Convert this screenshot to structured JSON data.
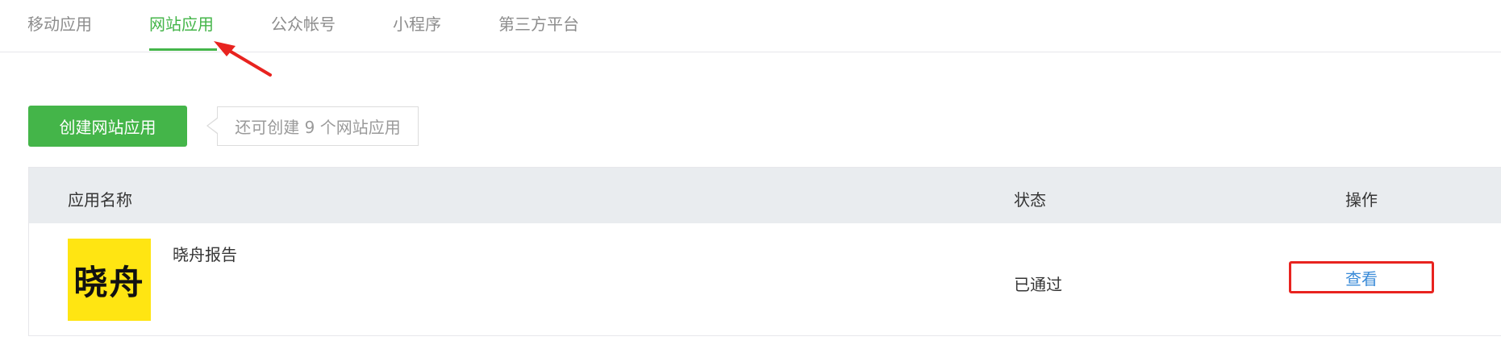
{
  "tabs": [
    {
      "label": "移动应用",
      "active": false
    },
    {
      "label": "网站应用",
      "active": true
    },
    {
      "label": "公众帐号",
      "active": false
    },
    {
      "label": "小程序",
      "active": false
    },
    {
      "label": "第三方平台",
      "active": false
    }
  ],
  "toolbar": {
    "create_label": "创建网站应用",
    "remaining_tip": "还可创建 9 个网站应用"
  },
  "table": {
    "headers": {
      "name": "应用名称",
      "status": "状态",
      "action": "操作"
    },
    "rows": [
      {
        "logo_text": "晓舟",
        "name": "晓舟报告",
        "status": "已通过",
        "action": "查看"
      }
    ]
  },
  "colors": {
    "accent": "#44b549",
    "link": "#3a8bd8",
    "highlight": "#e8231f",
    "logo_bg": "#ffe512"
  }
}
